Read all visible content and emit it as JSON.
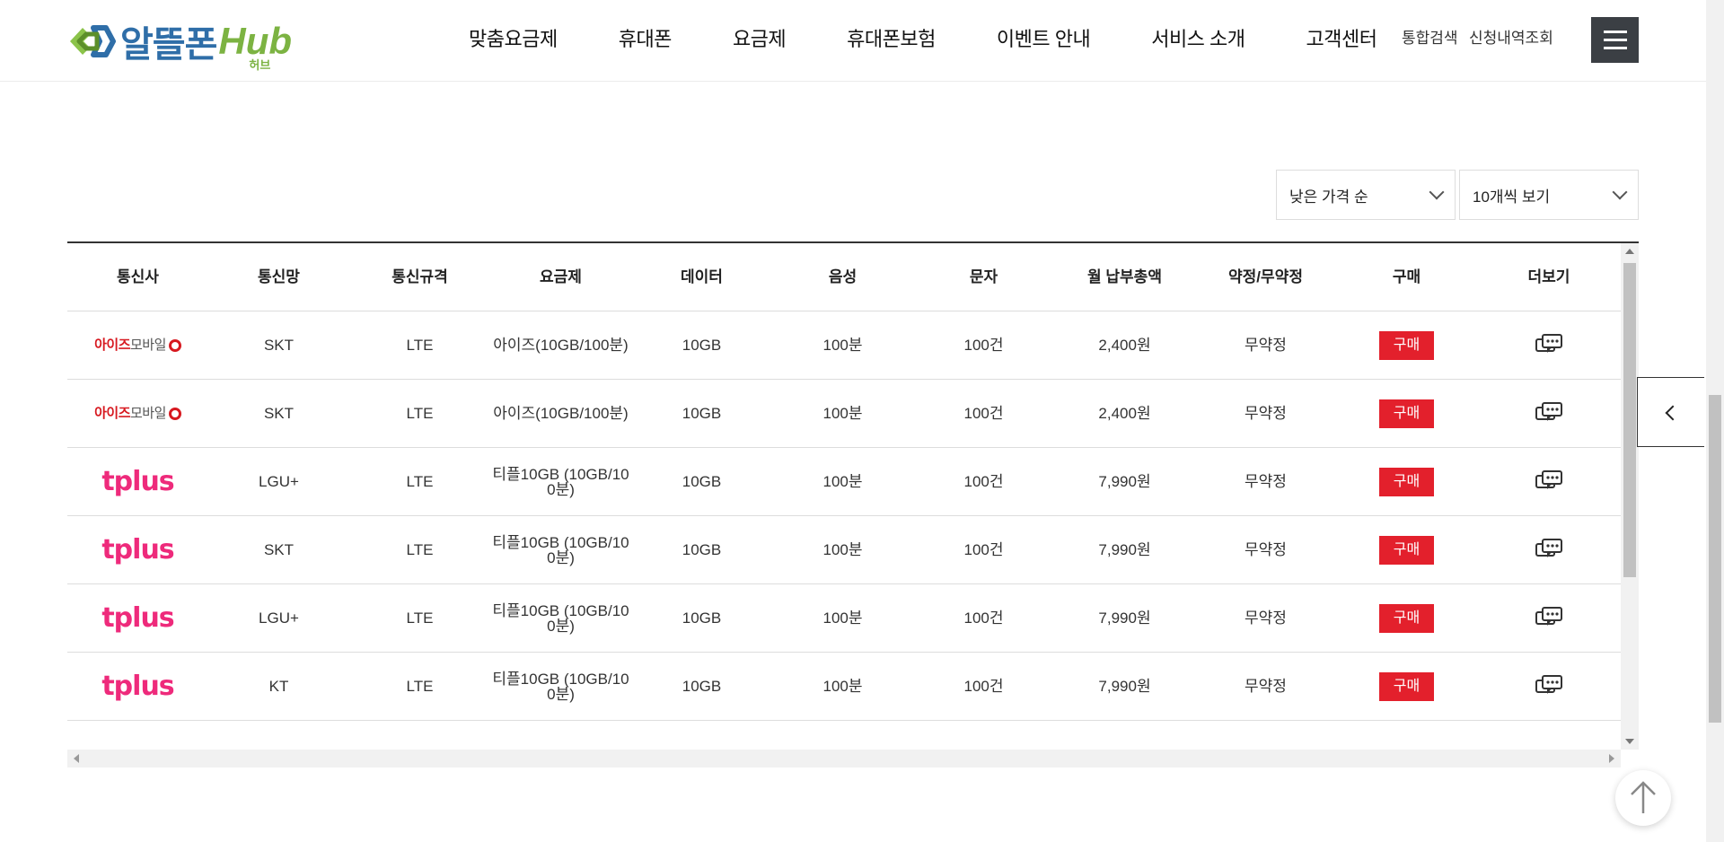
{
  "header": {
    "logo": {
      "text": "알뜰폰",
      "hub": "Hub",
      "sub": "허브"
    },
    "nav": [
      "맞춤요금제",
      "휴대폰",
      "요금제",
      "휴대폰보험",
      "이벤트 안내",
      "서비스 소개",
      "고객센터"
    ],
    "util": {
      "search": "통합검색",
      "lookup": "신청내역조회"
    }
  },
  "filters": {
    "sort": "낮은 가격 순",
    "per_page": "10개씩 보기"
  },
  "table": {
    "headers": [
      "통신사",
      "통신망",
      "통신규격",
      "요금제",
      "데이터",
      "음성",
      "문자",
      "월 납부총액",
      "약정/무약정",
      "구매",
      "더보기"
    ],
    "buy_label": "구매",
    "rows": [
      {
        "carrier": "aiz",
        "carrier_name": "아이즈",
        "carrier_suffix": "모바일",
        "network": "SKT",
        "standard": "LTE",
        "plan": "아이즈(10GB/100분)",
        "data": "10GB",
        "voice": "100분",
        "sms": "100건",
        "total": "2,400원",
        "contract": "무약정"
      },
      {
        "carrier": "aiz",
        "carrier_name": "아이즈",
        "carrier_suffix": "모바일",
        "network": "SKT",
        "standard": "LTE",
        "plan": "아이즈(10GB/100분)",
        "data": "10GB",
        "voice": "100분",
        "sms": "100건",
        "total": "2,400원",
        "contract": "무약정"
      },
      {
        "carrier": "tplus",
        "carrier_name": "tplus",
        "carrier_suffix": "",
        "network": "LGU+",
        "standard": "LTE",
        "plan": "티플10GB (10GB/100분)",
        "data": "10GB",
        "voice": "100분",
        "sms": "100건",
        "total": "7,990원",
        "contract": "무약정"
      },
      {
        "carrier": "tplus",
        "carrier_name": "tplus",
        "carrier_suffix": "",
        "network": "SKT",
        "standard": "LTE",
        "plan": "티플10GB (10GB/100분)",
        "data": "10GB",
        "voice": "100분",
        "sms": "100건",
        "total": "7,990원",
        "contract": "무약정"
      },
      {
        "carrier": "tplus",
        "carrier_name": "tplus",
        "carrier_suffix": "",
        "network": "LGU+",
        "standard": "LTE",
        "plan": "티플10GB (10GB/100분)",
        "data": "10GB",
        "voice": "100분",
        "sms": "100건",
        "total": "7,990원",
        "contract": "무약정"
      },
      {
        "carrier": "tplus",
        "carrier_name": "tplus",
        "carrier_suffix": "",
        "network": "KT",
        "standard": "LTE",
        "plan": "티플10GB (10GB/100분)",
        "data": "10GB",
        "voice": "100분",
        "sms": "100건",
        "total": "7,990원",
        "contract": "무약정"
      }
    ]
  },
  "icons": {
    "menu": "hamburger-icon",
    "more": "chat-bubbles-icon",
    "side_tab": "chevron-left-icon",
    "top": "arrow-up-icon"
  },
  "colors": {
    "buy": "#e3202c",
    "aiz": "#d71920",
    "tplus": "#ee2a7b",
    "menu_bg": "#3b3f44"
  }
}
